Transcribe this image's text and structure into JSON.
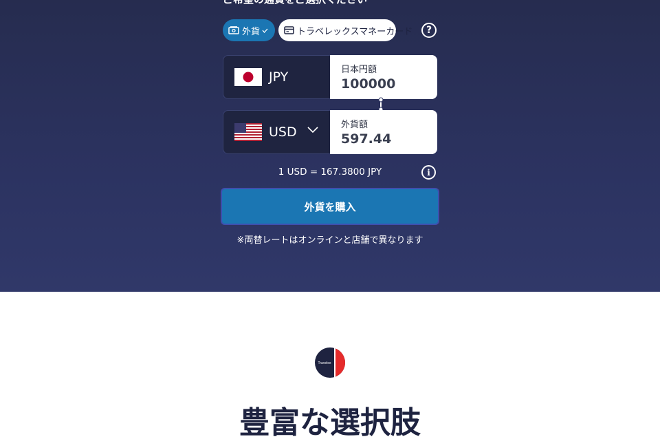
{
  "converter": {
    "title": "ご希望の通貨をご選択ください",
    "tabs": [
      {
        "label": "外貨",
        "active": true
      },
      {
        "label": "トラベレックスマネーカード",
        "active": false
      }
    ],
    "help_icon": "question-circle-icon",
    "from": {
      "code": "JPY",
      "flag": "japan-flag",
      "amount_label": "日本円額",
      "amount": "100000"
    },
    "to": {
      "code": "USD",
      "flag": "us-flag",
      "amount_label": "外貨額",
      "amount": "597.44"
    },
    "rate_text": "1 USD = 167.3800 JPY",
    "buy_label": "外貨を購入",
    "note": "※両替レートはオンラインと店舗で異なります"
  },
  "section": {
    "logo_text": "Travelex",
    "heading": "豊富な選択肢"
  },
  "colors": {
    "hero_bg": "#2c3361",
    "accent": "#1b76b3",
    "brand_red": "#e52b2b",
    "brand_navy": "#1e2340"
  }
}
